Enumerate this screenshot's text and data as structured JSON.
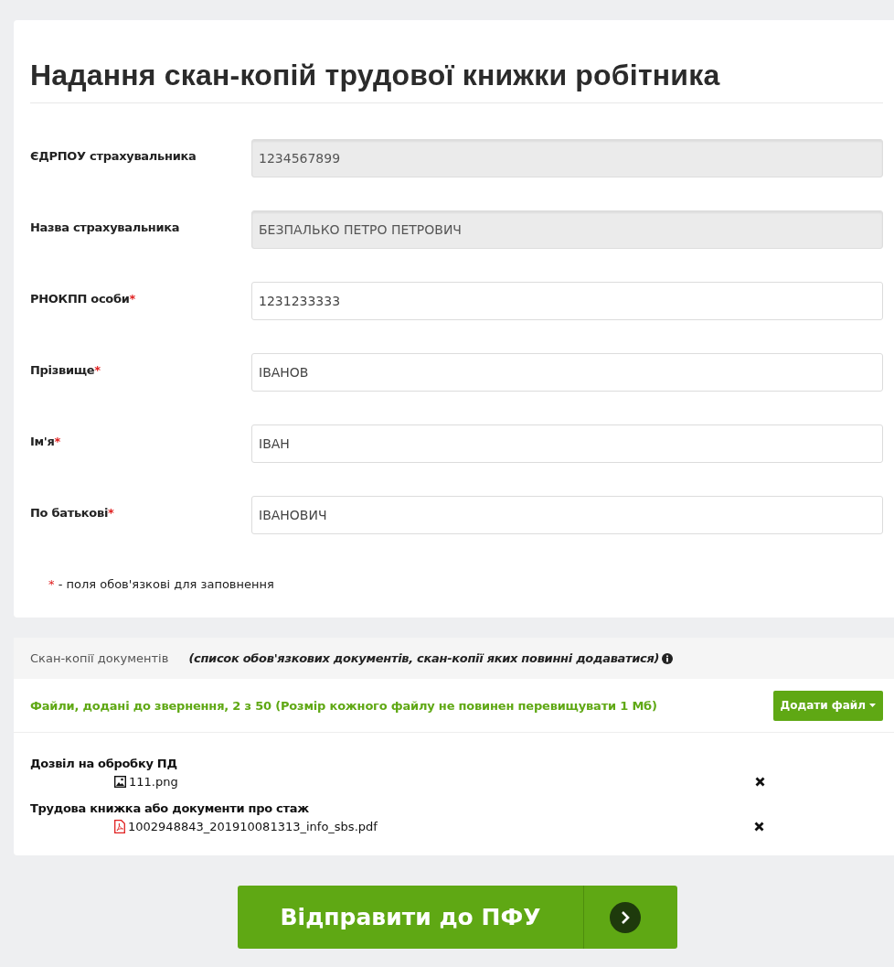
{
  "title": "Надання скан-копій трудової книжки робітника",
  "fields": [
    {
      "label": "ЄДРПОУ страхувальника",
      "value": "1234567899",
      "disabled": true
    },
    {
      "label": "Назва страхувальника",
      "value": "БЕЗПАЛЬКО ПЕТРО ПЕТРОВИЧ",
      "disabled": true
    },
    {
      "label": "РНОКПП особи",
      "required_mark": "*",
      "value": "1231233333",
      "disabled": false
    },
    {
      "label": "Прізвище",
      "required_mark": "*",
      "value": "ІВАНОВ",
      "disabled": false
    },
    {
      "label": "Ім'я",
      "required_mark": "*",
      "value": "ІВАН",
      "disabled": false
    },
    {
      "label": "По батькові",
      "required_mark": "*",
      "value": "ІВАНОВИЧ",
      "disabled": false
    }
  ],
  "required_note": {
    "mark": "*",
    "text": "- поля обов'язкові для заповнення"
  },
  "documents": {
    "heading": "Скан-копії документів",
    "hint": "(список обов'язкових документів, скан-копії яких повинні додаватися)",
    "files_info": "Файли, додані до звернення, 2 з 50 (Розмір кожного файлу не повинен перевищувати 1 Мб)",
    "add_button": "Додати файл",
    "groups": [
      {
        "title": "Дозвіл на обробку ПД",
        "files": [
          {
            "kind": "image",
            "name": "111.png"
          }
        ]
      },
      {
        "title": "Трудова книжка або документи про стаж",
        "files": [
          {
            "kind": "pdf",
            "name": "1002948843_201910081313_info_sbs.pdf"
          }
        ]
      }
    ]
  },
  "submit_button": "Відправити до ПФУ"
}
